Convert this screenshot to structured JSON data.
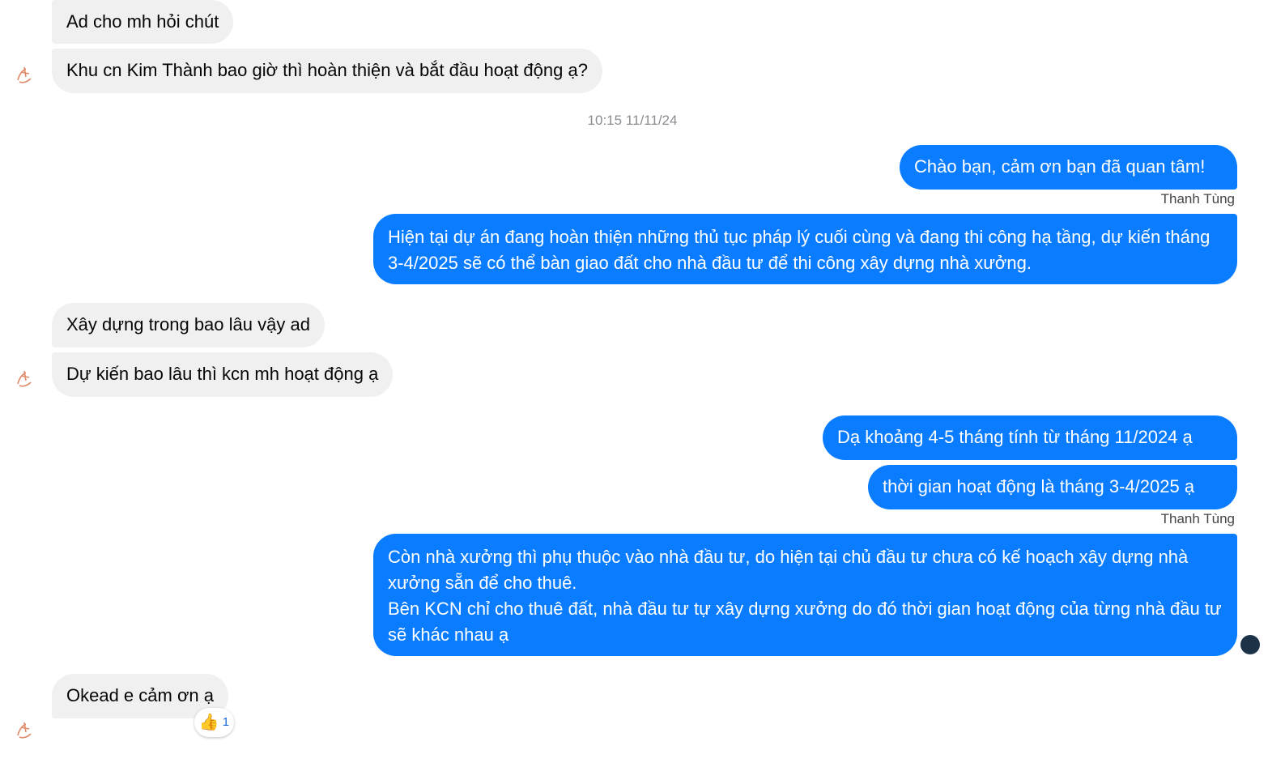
{
  "messages": {
    "m1": "Ad cho mh hỏi chút",
    "m2": "Khu cn Kim Thành bao giờ thì hoàn thiện và bắt đầu hoạt động ạ?",
    "timestamp": "10:15 11/11/24",
    "m3": "Chào bạn, cảm ơn bạn đã quan tâm!",
    "sender1": "Thanh Tùng",
    "m4": "Hiện tại dự án đang hoàn thiện những thủ tục pháp lý cuối cùng và đang thi công hạ tầng, dự kiến tháng 3-4/2025 sẽ có thể bàn giao đất cho nhà đầu tư để thi công xây dựng nhà xưởng.",
    "m5": "Xây dựng trong bao lâu vậy ad",
    "m6": "Dự kiến bao lâu thì kcn mh hoạt động ạ",
    "m7": "Dạ khoảng 4-5 tháng tính từ tháng 11/2024 ạ",
    "m8": "thời gian hoạt động là tháng 3-4/2025 ạ",
    "sender2": "Thanh Tùng",
    "m9_line1": "Còn nhà xưởng thì phụ thuộc vào nhà đầu tư, do hiện tại chủ đầu tư chưa có kế hoạch xây dựng nhà xưởng sẵn để cho thuê.",
    "m9_line2": "Bên KCN chỉ cho thuê đất, nhà đầu tư tự xây dựng xưởng do đó thời gian hoạt động của từng nhà đầu tư sẽ khác nhau ạ",
    "m10": "Okead e cảm ơn ạ",
    "reaction_emoji": "👍",
    "reaction_count": "1"
  },
  "icons": {
    "avatar": "hand-drawn-avatar-icon",
    "seen": "seen-avatar-icon",
    "reaction": "thumbs-up-icon"
  },
  "colors": {
    "outgoing": "#0a7cff",
    "incoming": "#f0f0f0"
  }
}
